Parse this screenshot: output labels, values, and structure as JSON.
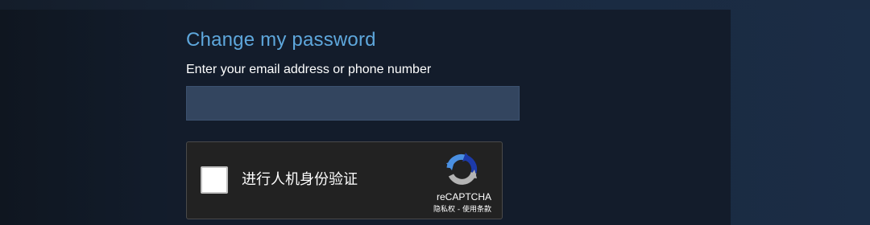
{
  "form": {
    "title": "Change my password",
    "email_label": "Enter your email address or phone number",
    "email_value": ""
  },
  "captcha": {
    "checkbox_label": "进行人机身份验证",
    "brand": "reCAPTCHA",
    "privacy_link": "隐私权",
    "separator": " - ",
    "terms_link": "使用条款",
    "checked": false,
    "logo_icon": "recaptcha-logo-icon",
    "colors": {
      "logo_blue": "#4a90e2",
      "logo_dark_blue": "#1c3aa9",
      "logo_gray": "#b4b4b4"
    }
  },
  "colors": {
    "title": "#5ea7dc",
    "input_bg": "#33455f",
    "panel_bg": "#131c2b",
    "captcha_bg": "#222222"
  }
}
